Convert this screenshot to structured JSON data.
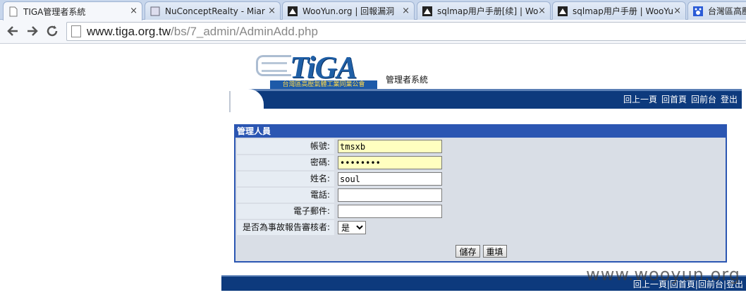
{
  "browser": {
    "tabs": [
      {
        "title": "TIGA管理者系統",
        "icon": "page-icon",
        "active": true
      },
      {
        "title": "NuConceptRealty - Miar",
        "icon": "page-icon",
        "active": false
      },
      {
        "title": "WooYun.org | 回報漏洞",
        "icon": "wooyun-icon",
        "active": false
      },
      {
        "title": "sqlmap用户手册[续] | Wo",
        "icon": "wooyun-icon",
        "active": false
      },
      {
        "title": "sqlmap用户手册 | WooYu",
        "icon": "wooyun-icon",
        "active": false
      },
      {
        "title": "台灣區高壓",
        "icon": "paw-icon",
        "active": false
      }
    ],
    "close_glyph": "×",
    "address": {
      "host": "www.tiga.org.tw",
      "path": "/bs/7_admin/AdminAdd.php"
    }
  },
  "site": {
    "logo_text": "TiGA",
    "logo_subtitle": "台灣區高壓氣體工業同業公會",
    "system_title": "管理者系統",
    "top_links": [
      "回上一頁",
      "回首頁",
      "回前台",
      "登出"
    ]
  },
  "form": {
    "header": "管理人員",
    "fields": [
      {
        "label": "帳號:",
        "value": "tmsxb",
        "type": "text",
        "highlight": true
      },
      {
        "label": "密碼:",
        "value": "••••••••",
        "type": "password",
        "highlight": true
      },
      {
        "label": "姓名:",
        "value": "soul",
        "type": "text",
        "highlight": false
      },
      {
        "label": "電話:",
        "value": "",
        "type": "text",
        "highlight": false
      },
      {
        "label": "電子郵件:",
        "value": "",
        "type": "text",
        "highlight": false
      },
      {
        "label": "是否為事故報告審核者:",
        "value": "是",
        "type": "select",
        "options": [
          "是"
        ]
      }
    ],
    "buttons": {
      "save": "儲存",
      "reset": "重填"
    }
  },
  "footer": {
    "links": "回上一頁|回首頁|回前台|登出"
  },
  "watermark": "www.wooyun.org",
  "colors": {
    "band": "#0d3a7d",
    "panel_border": "#2b56b2",
    "highlight_input": "#ffffc0"
  }
}
